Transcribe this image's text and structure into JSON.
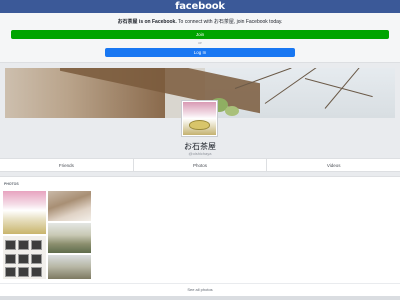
{
  "header": {
    "logo": "facebook"
  },
  "promo": {
    "page_name": "お石茶屋 is on Facebook.",
    "message": " To connect with お石茶屋, join Facebook today.",
    "join_label": "Join",
    "or_label": "or",
    "login_label": "Log In"
  },
  "profile": {
    "name": "お石茶屋",
    "handle": "@oishichaya"
  },
  "tabs": [
    {
      "label": "Friends"
    },
    {
      "label": "Photos"
    },
    {
      "label": "Videos"
    }
  ],
  "photos": {
    "section_label": "PHOTOS",
    "see_all_label": "See all photos"
  },
  "colors": {
    "brand": "#3b5998",
    "join": "#00a400",
    "login": "#1877f2"
  }
}
